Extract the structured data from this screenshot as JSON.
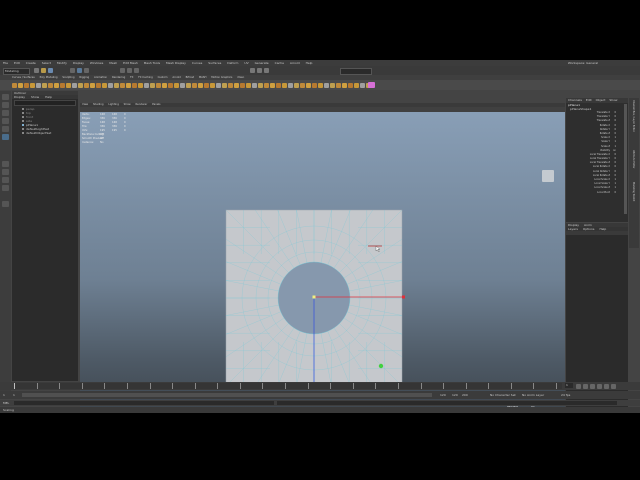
{
  "title_right": "Workspace: General",
  "menu": [
    "File",
    "Edit",
    "Create",
    "Select",
    "Modify",
    "Display",
    "Windows",
    "Mesh",
    "Edit Mesh",
    "Mesh Tools",
    "Mesh Display",
    "Curves",
    "Surfaces",
    "Deform",
    "UV",
    "Generate",
    "Cache",
    "Arnold",
    "Help"
  ],
  "mode_dropdown": "Modeling",
  "shelf_tabs": [
    "Curves / Surfaces",
    "Poly Modeling",
    "Sculpting",
    "Rigging",
    "Animation",
    "Rendering",
    "FX",
    "FX Caching",
    "Custom",
    "Arnold",
    "Bifrost",
    "MASH",
    "Motion Graphics",
    "XGen"
  ],
  "outliner": {
    "title": "Outliner",
    "menu": [
      "Display",
      "Show",
      "Help"
    ],
    "items": [
      "persp",
      "top",
      "front",
      "side",
      "pPlane1",
      "defaultLightSet",
      "defaultObjectSet"
    ]
  },
  "viewport": {
    "menu": [
      "View",
      "Shading",
      "Lighting",
      "Show",
      "Renderer",
      "Panels"
    ],
    "camera_label": "persp",
    "hud_rows": [
      {
        "label": "Verts:",
        "a": "168",
        "b": "168",
        "c": "0"
      },
      {
        "label": "Edges:",
        "a": "336",
        "b": "336",
        "c": "0"
      },
      {
        "label": "Faces:",
        "a": "168",
        "b": "168",
        "c": "0"
      },
      {
        "label": "Tris:",
        "a": "336",
        "b": "336",
        "c": "0"
      },
      {
        "label": "UVs:",
        "a": "195",
        "b": "195",
        "c": "0"
      },
      {
        "label": "Backface Culling:",
        "a": "Off",
        "b": "",
        "c": ""
      },
      {
        "label": "Smooth Preview:",
        "a": "Off",
        "b": "",
        "c": ""
      },
      {
        "label": "Instance:",
        "a": "No",
        "b": "",
        "c": ""
      }
    ],
    "stats": [
      {
        "label": "Backface",
        "value": "Off"
      },
      {
        "label": "Memory Used",
        "value": "304"
      },
      {
        "label": "GPU Memory Used",
        "value": "256"
      },
      {
        "label": "Frames Rate",
        "value": "59.9"
      }
    ]
  },
  "channel_box": {
    "tabs": [
      "Channels",
      "Edit",
      "Object",
      "Show"
    ],
    "object": "pPlane1",
    "shape": "pPlaneShape1",
    "attributes": [
      {
        "name": "Translate X",
        "value": "0"
      },
      {
        "name": "Translate Y",
        "value": "0"
      },
      {
        "name": "Translate Z",
        "value": "0"
      },
      {
        "name": "Rotate X",
        "value": "0"
      },
      {
        "name": "Rotate Y",
        "value": "0"
      },
      {
        "name": "Rotate Z",
        "value": "0"
      },
      {
        "name": "Scale X",
        "value": "1"
      },
      {
        "name": "Scale Y",
        "value": "1"
      },
      {
        "name": "Scale Z",
        "value": "1"
      },
      {
        "name": "Visibility",
        "value": "on"
      },
      {
        "name": "Local Translate X",
        "value": "0"
      },
      {
        "name": "Local Translate Y",
        "value": "0"
      },
      {
        "name": "Local Translate Z",
        "value": "0"
      },
      {
        "name": "Local Rotate X",
        "value": "0"
      },
      {
        "name": "Local Rotate Y",
        "value": "0"
      },
      {
        "name": "Local Rotate Z",
        "value": "0"
      },
      {
        "name": "Local Scale X",
        "value": "1"
      },
      {
        "name": "Local Scale Y",
        "value": "1"
      },
      {
        "name": "Local Scale Z",
        "value": "1"
      },
      {
        "name": "Local Pivot",
        "value": "0"
      }
    ],
    "side_tabs": [
      "Channel Box / Layer Editor",
      "Attribute Editor",
      "Modeling Toolkit"
    ]
  },
  "layer_editor": {
    "tabs": [
      "Display",
      "Anim"
    ],
    "menu": [
      "Layers",
      "Options",
      "Help"
    ]
  },
  "timeline": {
    "ticks": [
      "1",
      "5",
      "10",
      "15",
      "20",
      "25",
      "30",
      "35",
      "40",
      "45",
      "50",
      "55",
      "60",
      "65",
      "70",
      "75",
      "80",
      "85",
      "90",
      "95",
      "100",
      "105",
      "110",
      "115",
      "120"
    ],
    "current_frame": "1"
  },
  "range": {
    "start": "1",
    "start_inner": "1",
    "end_inner": "120",
    "end": "120",
    "end_outer": "200",
    "fps": "24 fps",
    "char_set": "No Character Set",
    "anim_layer": "No Anim Layer"
  },
  "status": {
    "label": "MEL",
    "help": "Scaling"
  },
  "colors": {
    "app_bg": "#444444",
    "panel_bg": "#2b2b2b",
    "mesh_face": "#c5c8cc",
    "wire": "#6ec8d8",
    "axis_x": "#e0303a",
    "axis_y": "#3050e0",
    "selection": "#d870d8"
  }
}
